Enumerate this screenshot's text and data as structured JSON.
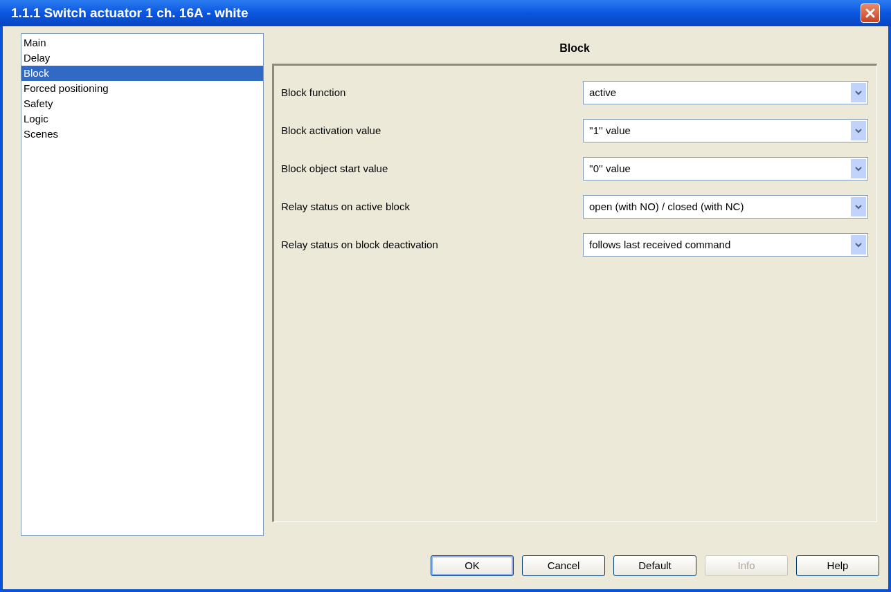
{
  "window": {
    "title": "1.1.1 Switch actuator 1 ch. 16A - white"
  },
  "sidebar": {
    "items": [
      {
        "label": "Main",
        "selected": false
      },
      {
        "label": "Delay",
        "selected": false
      },
      {
        "label": "Block",
        "selected": true
      },
      {
        "label": "Forced positioning",
        "selected": false
      },
      {
        "label": "Safety",
        "selected": false
      },
      {
        "label": "Logic",
        "selected": false
      },
      {
        "label": "Scenes",
        "selected": false
      }
    ]
  },
  "panel": {
    "title": "Block",
    "parameters": [
      {
        "label": "Block function",
        "value": "active"
      },
      {
        "label": "Block activation value",
        "value": "''1'' value"
      },
      {
        "label": "Block object start value",
        "value": "''0'' value"
      },
      {
        "label": "Relay status on active block",
        "value": "open (with NO) / closed (with NC)"
      },
      {
        "label": "Relay status on block deactivation",
        "value": "follows last received command"
      }
    ]
  },
  "buttons": [
    {
      "label": "OK",
      "default": true,
      "disabled": false
    },
    {
      "label": "Cancel",
      "default": false,
      "disabled": false
    },
    {
      "label": "Default",
      "default": false,
      "disabled": false
    },
    {
      "label": "Info",
      "default": false,
      "disabled": true
    },
    {
      "label": "Help",
      "default": false,
      "disabled": false
    }
  ]
}
